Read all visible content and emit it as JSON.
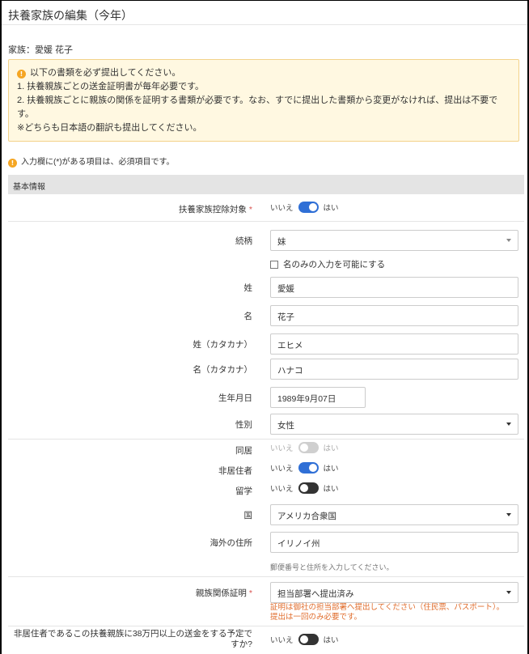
{
  "header": {
    "title": "扶養家族の編集（今年）"
  },
  "family": {
    "label": "家族：愛媛 花子"
  },
  "notice": {
    "icon": "info-icon",
    "heading": "以下の書類を必ず提出してください。",
    "line1": "1. 扶養親族ごとの送金証明書が毎年必要です。",
    "line2": "2. 扶養親族ごとに親族の関係を証明する書類が必要です。なお、すでに提出した書類から変更がなければ、提出は不要です。",
    "line3": "※どちらも日本語の翻訳も提出してください。"
  },
  "required_note": {
    "text": "入力欄に(*)がある項目は、必須項目です。"
  },
  "section": {
    "title": "基本情報"
  },
  "toggle_labels": {
    "no": "いいえ",
    "yes": "はい"
  },
  "fields": {
    "dependent_deduction": {
      "label": "扶養家族控除対象",
      "required": "*",
      "value": true
    },
    "relationship": {
      "label": "続柄",
      "value": "妹"
    },
    "name_only": {
      "label": "名のみの入力を可能にする",
      "checked": false
    },
    "last_name": {
      "label": "姓",
      "value": "愛媛"
    },
    "first_name": {
      "label": "名",
      "value": "花子"
    },
    "last_name_kana": {
      "label": "姓（カタカナ）",
      "value": "エヒメ"
    },
    "first_name_kana": {
      "label": "名（カタカナ）",
      "value": "ハナコ"
    },
    "birthdate": {
      "label": "生年月日",
      "value": "1989年9月07日"
    },
    "gender": {
      "label": "性別",
      "value": "女性"
    },
    "cohabiting": {
      "label": "同居",
      "value": false,
      "disabled": true
    },
    "non_resident": {
      "label": "非居住者",
      "value": true
    },
    "study_abroad": {
      "label": "留学",
      "value": false
    },
    "country": {
      "label": "国",
      "value": "アメリカ合衆国"
    },
    "overseas_address": {
      "label": "海外の住所",
      "value": "イリノイ州",
      "help": "郵便番号と住所を入力してください。"
    },
    "relation_proof": {
      "label": "親族関係証明",
      "required": "*",
      "value": "担当部署へ提出済み",
      "warning": "証明は御社の担当部署へ提出してください（住民票、パスポート）。提出は一回のみ必要です。"
    },
    "remittance_question": {
      "label": "非居住者であるこの扶養親族に38万円以上の送金をする予定ですか?",
      "value": false
    }
  },
  "colors": {
    "toggle_on": "#2f6fd6",
    "toggle_off": "#333333",
    "notice_bg": "#fff8e1",
    "warning_text": "#e06c2b",
    "required_mark": "#d9534f"
  }
}
